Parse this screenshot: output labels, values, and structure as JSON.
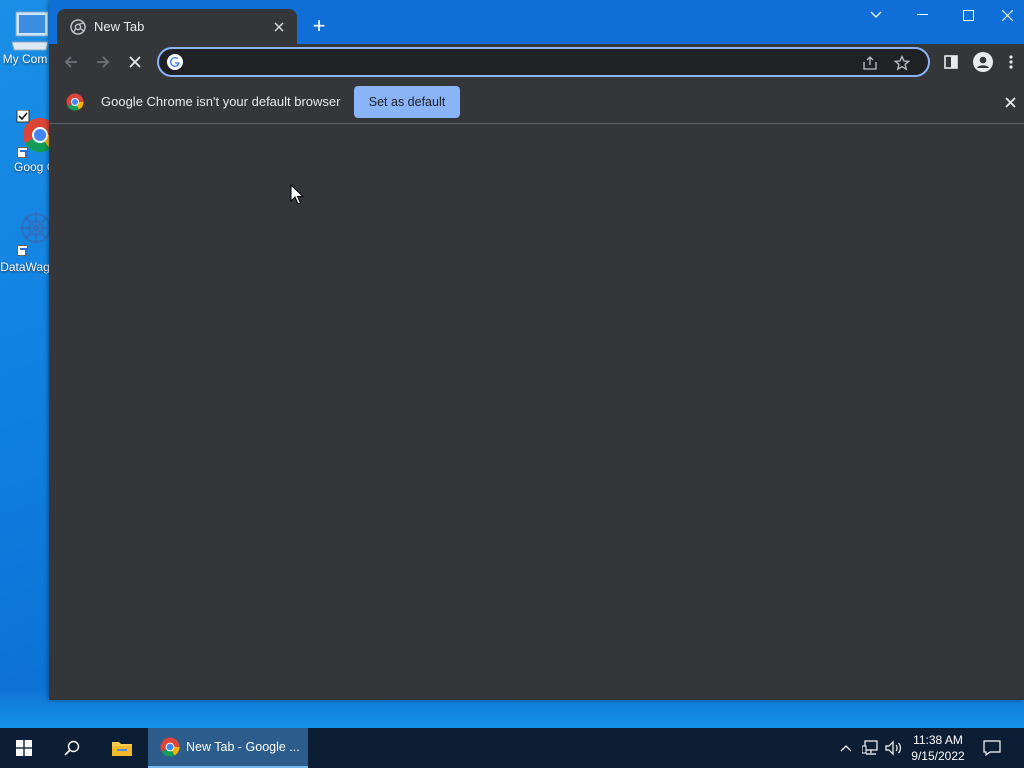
{
  "desktop": {
    "icons": [
      {
        "label": "My Com",
        "icon": "computer-icon"
      },
      {
        "label": "Goog Chron",
        "icon": "chrome-icon"
      },
      {
        "label": "DataWag",
        "icon": "datawagon-icon"
      }
    ]
  },
  "browser": {
    "tab": {
      "title": "New Tab",
      "icon": "chrome-tab-icon"
    },
    "new_tab_symbol": "+",
    "window_controls": [
      "tab-search",
      "minimize",
      "maximize",
      "close"
    ],
    "address_bar": {
      "value": "",
      "placeholder": ""
    },
    "infobar": {
      "message": "Google Chrome isn't your default browser",
      "button": "Set as default"
    },
    "colors": {
      "titlebar": "#0f6fd6",
      "frame": "#35363a",
      "accent": "#8ab4f8"
    }
  },
  "taskbar": {
    "running_app": "New Tab - Google ...",
    "clock_time": "11:38 AM",
    "clock_date": "9/15/2022"
  }
}
